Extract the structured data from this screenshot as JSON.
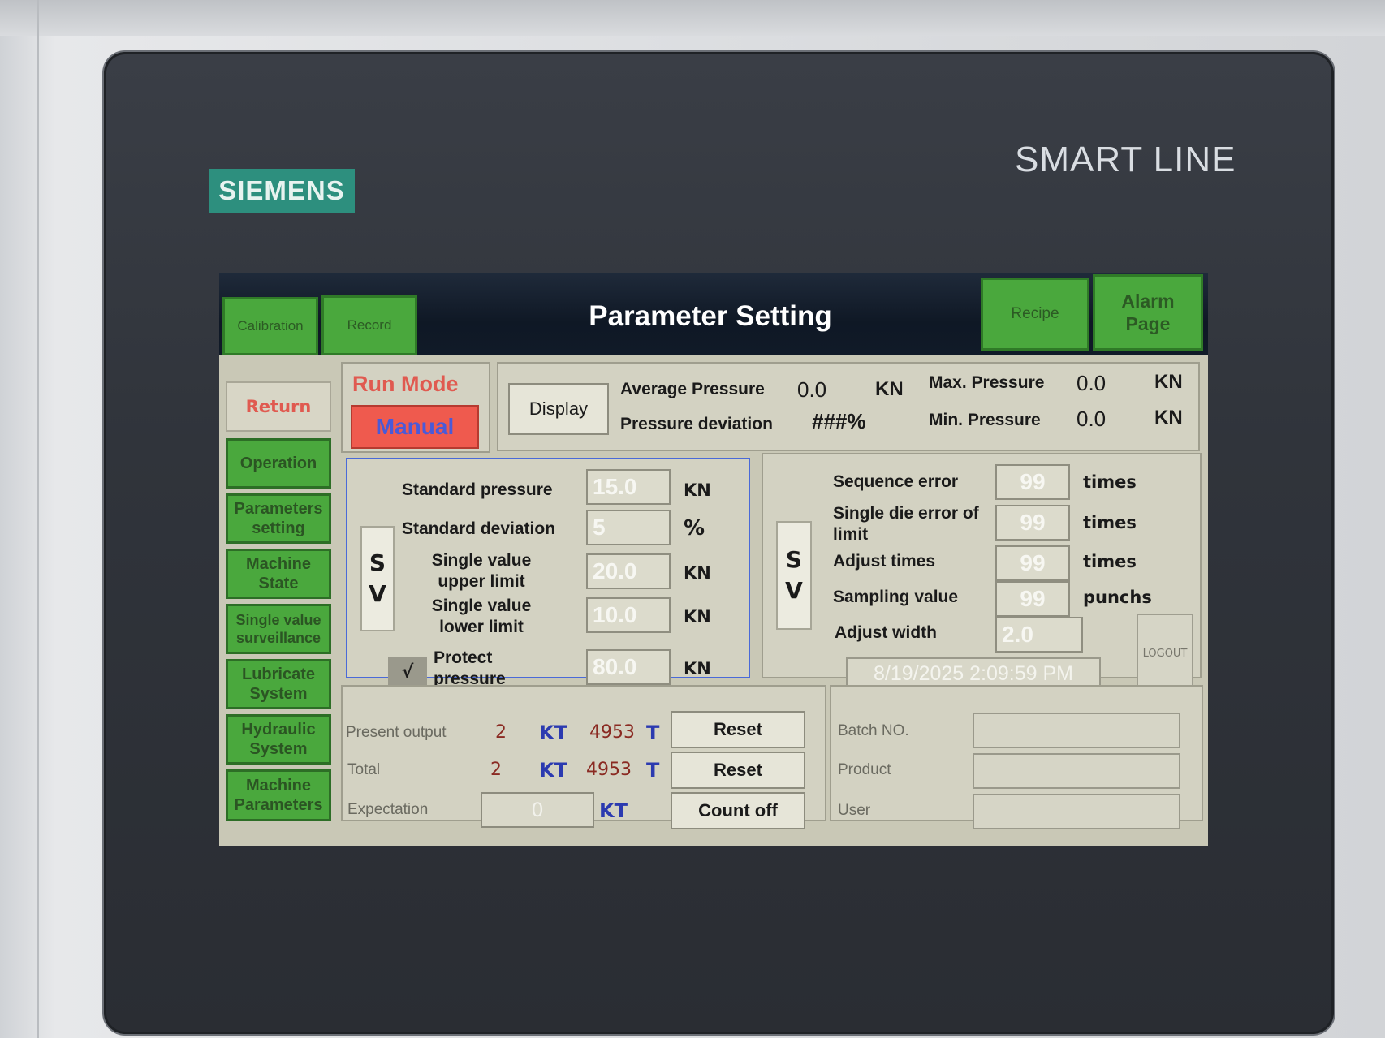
{
  "device": {
    "brand": "SIEMENS",
    "series": "SMART LINE"
  },
  "header": {
    "title": "Parameter Setting",
    "tabs": [
      "Calibration",
      "Record"
    ],
    "right_buttons": [
      "Recipe",
      "Alarm Page"
    ]
  },
  "nav": {
    "return_label": "Return",
    "items": [
      "Operation",
      "Parameters setting",
      "Machine State",
      "Single value surveillance",
      "Lubricate System",
      "Hydraulic System",
      "Machine Parameters"
    ]
  },
  "run_mode": {
    "label": "Run Mode",
    "value": "Manual"
  },
  "display_panel": {
    "button": "Display",
    "avg_pressure_label": "Average Pressure",
    "avg_pressure_value": "0.0",
    "avg_pressure_unit": "KN",
    "max_pressure_label": "Max. Pressure",
    "max_pressure_value": "0.0",
    "max_pressure_unit": "KN",
    "deviation_label": "Pressure deviation",
    "deviation_value": "###%",
    "min_pressure_label": "Min. Pressure",
    "min_pressure_value": "0.0",
    "min_pressure_unit": "KN"
  },
  "left_params": {
    "sv_top": "S",
    "sv_bottom": "V",
    "rows": [
      {
        "label": "Standard pressure",
        "value": "15.0",
        "unit": "KN"
      },
      {
        "label": "Standard deviation",
        "value": "5",
        "unit": "%"
      },
      {
        "label": "Single value upper limit",
        "value": "20.0",
        "unit": "KN"
      },
      {
        "label": "Single value lower limit",
        "value": "10.0",
        "unit": "KN"
      },
      {
        "label": "Protect pressure",
        "value": "80.0",
        "unit": "KN"
      }
    ],
    "protect_check": "√"
  },
  "right_params": {
    "sv_top": "S",
    "sv_bottom": "V",
    "rows": [
      {
        "label": "Sequence error",
        "value": "99",
        "unit": "times"
      },
      {
        "label": "Single die error of limit",
        "value": "99",
        "unit": "times"
      },
      {
        "label": "Adjust times",
        "value": "99",
        "unit": "times"
      },
      {
        "label": "Sampling value",
        "value": "99",
        "unit": "punchs"
      },
      {
        "label": "Adjust width",
        "value": "2.0",
        "unit": ""
      }
    ],
    "datetime": "8/19/2025 2:09:59 PM",
    "logout": "LOGOUT"
  },
  "counters": {
    "present": {
      "label": "Present output",
      "kt": "2",
      "kt_unit": "KT",
      "t": "4953",
      "t_unit": "T",
      "button": "Reset"
    },
    "total": {
      "label": "Total",
      "kt": "2",
      "kt_unit": "KT",
      "t": "4953",
      "t_unit": "T",
      "button": "Reset"
    },
    "expectation": {
      "label": "Expectation",
      "value": "0",
      "unit": "KT",
      "button": "Count off"
    }
  },
  "batch": {
    "fields": [
      {
        "label": "Batch NO.",
        "value": ""
      },
      {
        "label": "Product",
        "value": ""
      },
      {
        "label": "User",
        "value": ""
      }
    ]
  },
  "colors": {
    "accent_green": "#4aa83d",
    "manual_red": "#ef5a4e",
    "manual_text": "#4a5ad8",
    "title_bar": "#0f1825"
  }
}
